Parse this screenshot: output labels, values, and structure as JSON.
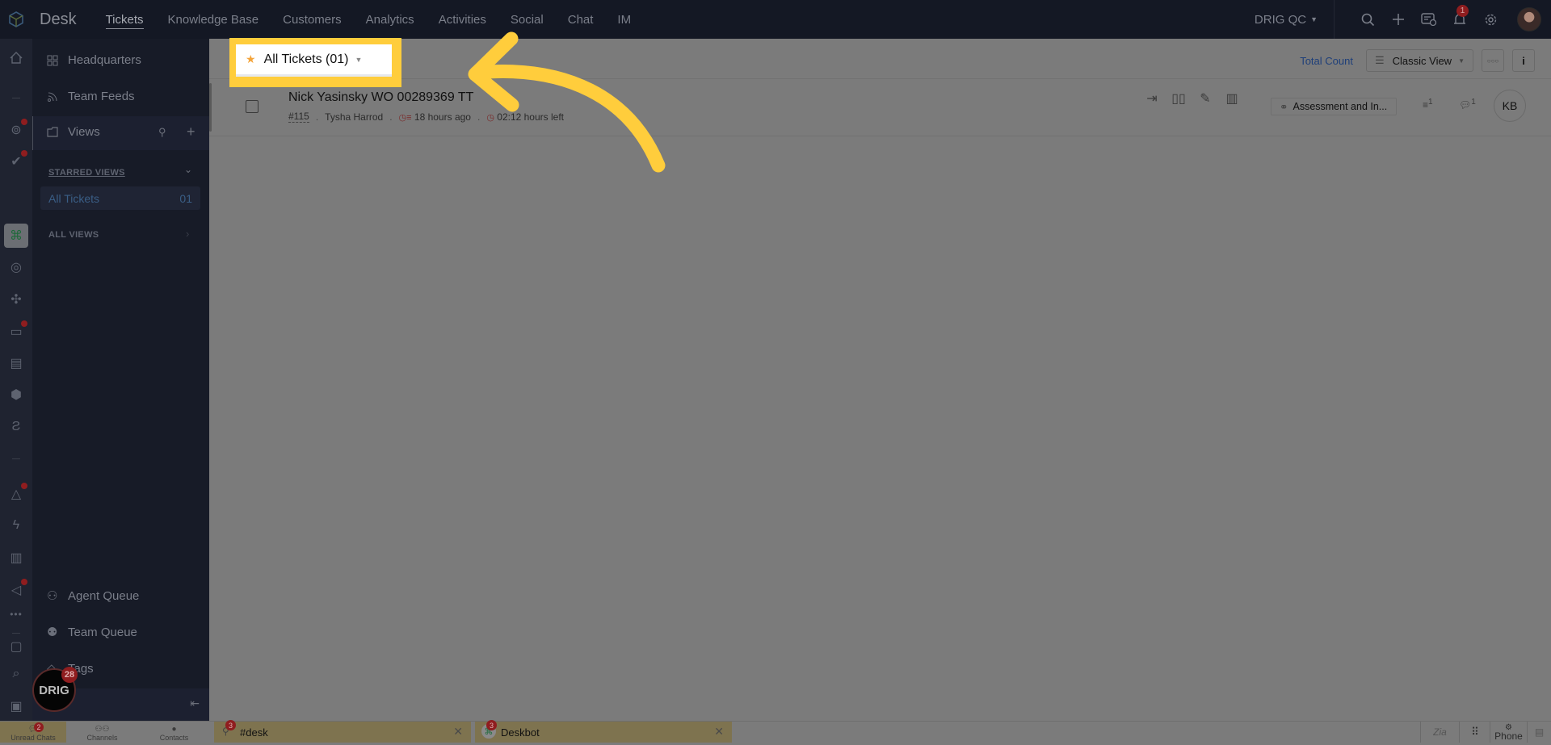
{
  "app": {
    "brand": "Desk",
    "nav": [
      "Tickets",
      "Knowledge Base",
      "Customers",
      "Analytics",
      "Activities",
      "Social",
      "Chat",
      "IM"
    ],
    "active_nav": "Tickets",
    "org": "DRIG QC",
    "notification_count": "1"
  },
  "sidebar": {
    "headquarters": "Headquarters",
    "team_feeds": "Team Feeds",
    "views": "Views",
    "starred_heading": "STARRED VIEWS",
    "starred_items": [
      {
        "label": "All Tickets",
        "count": "01"
      }
    ],
    "all_views_heading": "ALL VIEWS",
    "agent_queue": "Agent Queue",
    "team_queue": "Team Queue",
    "tags": "Tags"
  },
  "toolbar": {
    "view_title": "All Tickets (01)",
    "total_count": "Total Count",
    "view_mode": "Classic View"
  },
  "tickets": [
    {
      "subject": "Nick Yasinsky WO 00289369 TT",
      "number": "#115",
      "contact": "Tysha Harrod",
      "created": "18 hours ago",
      "due": "02:12 hours left",
      "department": "Assessment and In...",
      "thread_count": "1",
      "comment_count": "1",
      "assignee_initials": "KB"
    }
  ],
  "bottombar": {
    "unread_chats": "Unread Chats",
    "unread_count": "2",
    "channels": "Channels",
    "contacts": "Contacts",
    "chat_tabs": [
      {
        "name": "#desk",
        "badge": "3"
      },
      {
        "name": "Deskbot",
        "badge": "3"
      }
    ],
    "phone": "Phone"
  },
  "floating_badge": {
    "label": "DRIG",
    "count": "28"
  },
  "annotation": {
    "highlight_color": "#ffcd3c",
    "arrow_color": "#ffcd3c"
  }
}
